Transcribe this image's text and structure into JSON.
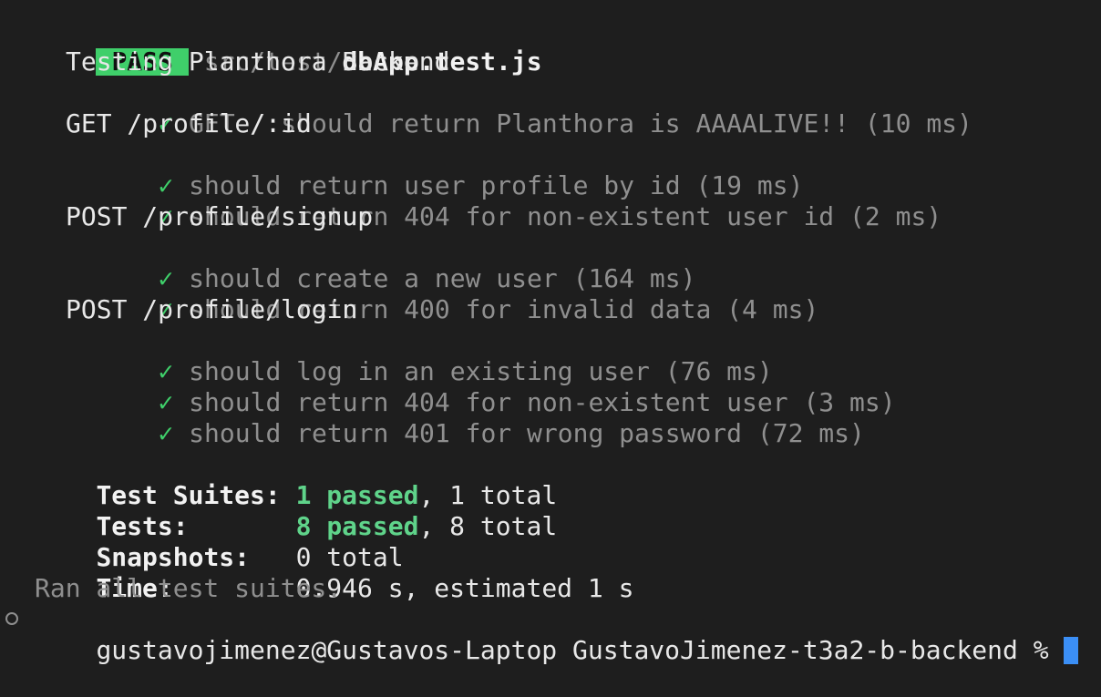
{
  "header": {
    "badge": "PASS",
    "path_dir": "src/test/",
    "path_file": "dbApp.test.js"
  },
  "suite_title": "Testing Planthora Backend",
  "groups": [
    {
      "title": "",
      "tests": [
        {
          "check": "✓",
          "text": "GET / should return Planthora is AAAALIVE!! (10 ms)"
        }
      ]
    },
    {
      "title": "GET /profile/:id",
      "tests": [
        {
          "check": "✓",
          "text": "should return user profile by id (19 ms)"
        },
        {
          "check": "✓",
          "text": "should return 404 for non-existent user id (2 ms)"
        }
      ]
    },
    {
      "title": "POST /profile/signup",
      "tests": [
        {
          "check": "✓",
          "text": "should create a new user (164 ms)"
        },
        {
          "check": "✓",
          "text": "should return 400 for invalid data (4 ms)"
        }
      ]
    },
    {
      "title": "POST /profile/login",
      "tests": [
        {
          "check": "✓",
          "text": "should log in an existing user (76 ms)"
        },
        {
          "check": "✓",
          "text": "should return 404 for non-existent user (3 ms)"
        },
        {
          "check": "✓",
          "text": "should return 401 for wrong password (72 ms)"
        }
      ]
    }
  ],
  "summary": {
    "suites_label": "Test Suites:",
    "suites_passed": "1 passed",
    "suites_rest": ", 1 total",
    "tests_label": "Tests:",
    "tests_passed": "8 passed",
    "tests_rest": ", 8 total",
    "snapshots_label": "Snapshots:",
    "snapshots_value": "0 total",
    "time_label": "Time:",
    "time_value": "0.946 s, estimated 1 s",
    "ran_all": "Ran all test suites."
  },
  "prompt": {
    "text": "gustavojimenez@Gustavos-Laptop GustavoJimenez-t3a2-b-backend %"
  },
  "colors": {
    "background": "#1e1e1e",
    "pass_badge": "#3fcf6a",
    "check": "#3fcf6a",
    "passed_text": "#5fd38a",
    "dim_text": "#8f8f8f",
    "cursor": "#3b8ff6"
  }
}
